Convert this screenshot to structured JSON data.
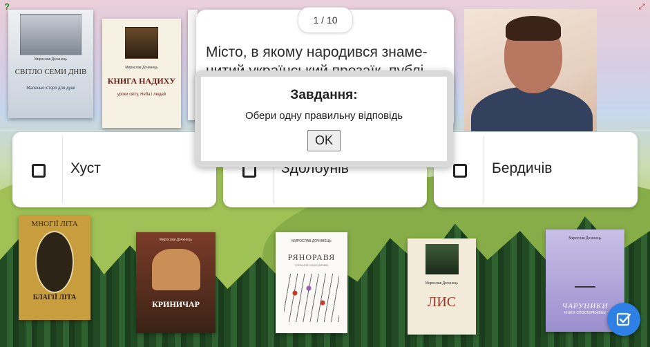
{
  "corner": {
    "help_icon": "help-question-icon",
    "fullscreen_icon": "fullscreen-arrows-icon"
  },
  "counter": "1 / 10",
  "question": {
    "text": "Місто, в якому народився знаме-нитий український прозаїк, публі-"
  },
  "answers": [
    {
      "label": "Хуст"
    },
    {
      "label": "Здолбунів"
    },
    {
      "label": "Бердичів"
    }
  ],
  "modal": {
    "title": "Завдання:",
    "text": "Обери одну правильну відповідь",
    "ok_label": "OK"
  },
  "books": {
    "svitlo": {
      "author": "Мирослав Дочинець",
      "title": "СВІТЛО СЕМИ ДНІВ",
      "subtitle": "Маленькі історії для душі"
    },
    "nadiya": {
      "author": "Мирослав Дочинець",
      "title": "КНИГА НАДИХУ",
      "subtitle": "уроки світу, Неба і людей"
    },
    "mnohi": {
      "top": "МНОГІЇ ЛІТА",
      "title": "БЛАГІЇ ЛІТА",
      "spine": "Мирослав Дочинець"
    },
    "krynychar": {
      "author": "Мирослав Дочинець",
      "title": "КРИНИЧАР"
    },
    "ryanoravya": {
      "author": "МИРОСЛАВ ДОЧИНЕЦЬ",
      "title": "РЯНОРАВЯ",
      "subtitle": "ГЕРБАРІЙ СИНІХ ВІРШІВ"
    },
    "lys": {
      "author": "Мирослав Дочинець",
      "title": "ЛИС"
    },
    "charuvnyk": {
      "author": "Мирослав Дочинець",
      "title": "ЧАРУНИКИ",
      "subtitle": "КНИГА СПОСТЕРЕЖЕНЬ"
    }
  },
  "colors": {
    "accent": "#2f80e4",
    "card": "#ffffff",
    "modal_frame": "#d9d9d9"
  },
  "fab": {
    "icon": "check-square-icon"
  }
}
